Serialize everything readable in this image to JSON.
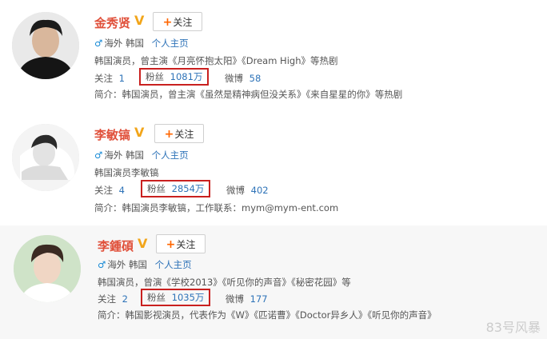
{
  "profiles": [
    {
      "name": "金秀贤",
      "follow_label": "关注",
      "region": "海外 韩国",
      "homepage": "个人主页",
      "description": "韩国演员，曾主演《月亮怀抱太阳》《Dream High》等热剧",
      "following_label": "关注",
      "following_count": "1",
      "fans_label": "粉丝",
      "fans_count": "1081万",
      "weibo_label": "微博",
      "weibo_count": "58",
      "intro": "简介：韩国演员，曾主演《虽然是精神病但没关系》《来自星星的你》等热剧"
    },
    {
      "name": "李敏镐",
      "follow_label": "关注",
      "region": "海外 韩国",
      "homepage": "个人主页",
      "description": "韩国演员李敏镐",
      "following_label": "关注",
      "following_count": "4",
      "fans_label": "粉丝",
      "fans_count": "2854万",
      "weibo_label": "微博",
      "weibo_count": "402",
      "intro": "简介：韩国演员李敏镐，工作联系：mym@mym-ent.com"
    },
    {
      "name": "李鍾碩",
      "follow_label": "关注",
      "region": "海外 韩国",
      "homepage": "个人主页",
      "description": "韩国演员，曾演《学校2013》《听见你的声音》《秘密花园》等",
      "following_label": "关注",
      "following_count": "2",
      "fans_label": "粉丝",
      "fans_count": "1035万",
      "weibo_label": "微博",
      "weibo_count": "177",
      "intro": "简介：韩国影视演员，代表作为《W》《匹诺曹》《Doctor异乡人》《听见你的声音》"
    }
  ],
  "watermark": "83号风暴",
  "colors": {
    "name": "#e0503a",
    "link": "#2e73b8",
    "highlight_box": "#c9201f",
    "verified": "#f2a51a"
  }
}
